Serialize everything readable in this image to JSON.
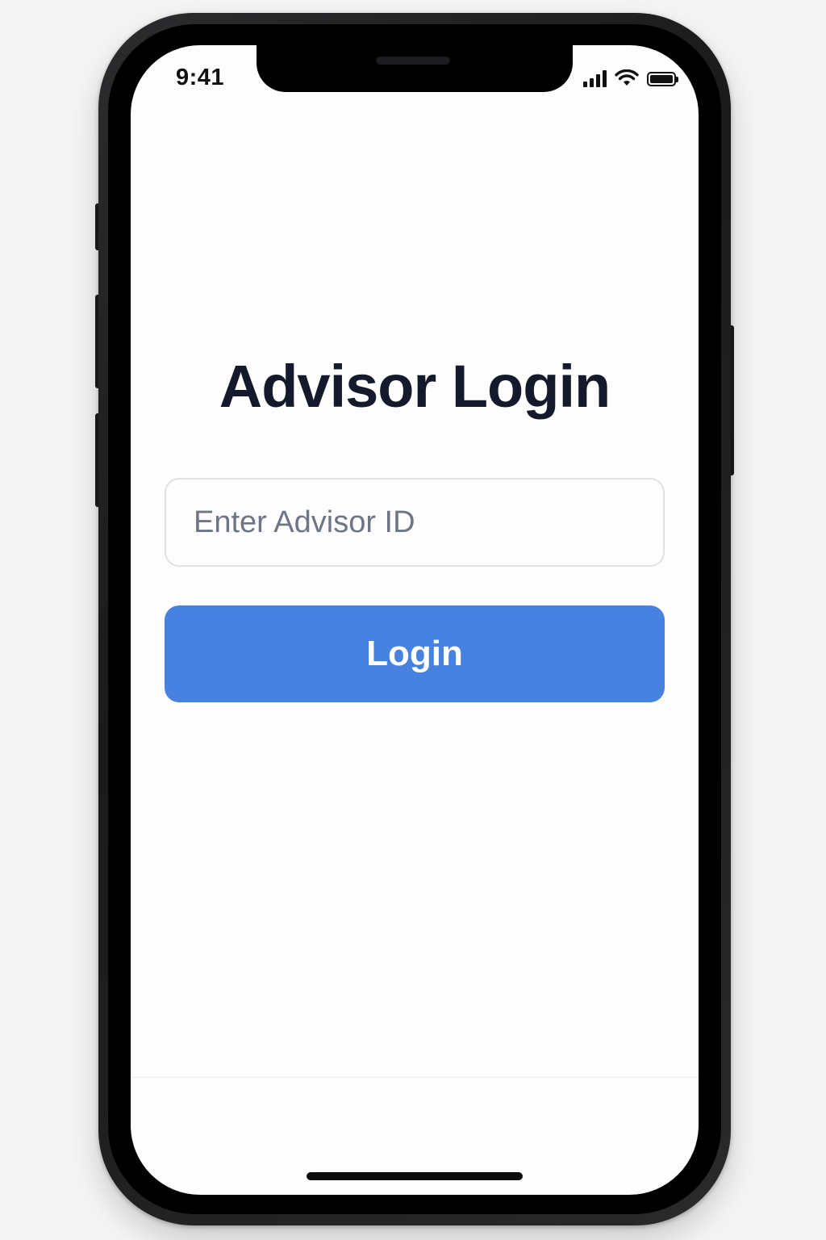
{
  "status_bar": {
    "time": "9:41",
    "signal_icon": "cellular-signal-icon",
    "wifi_icon": "wifi-icon",
    "battery_icon": "battery-full-icon"
  },
  "login": {
    "title": "Advisor Login",
    "advisor_id_placeholder": "Enter Advisor ID",
    "advisor_id_value": "",
    "button_label": "Login"
  },
  "colors": {
    "accent": "#4782e0",
    "title_text": "#141a2b",
    "placeholder_text": "#6e7585",
    "input_border": "#e0e1e6"
  }
}
